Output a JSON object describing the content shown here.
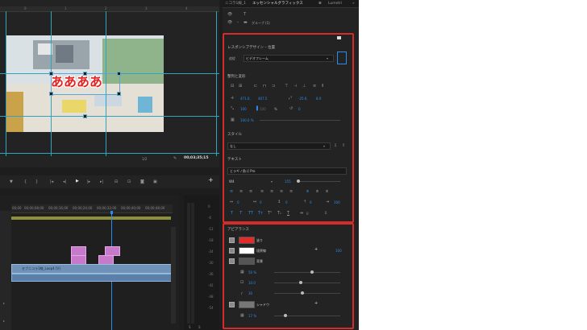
{
  "monitor": {
    "timecode": "00;03;35;15",
    "fit": "1/2",
    "overlay_text": "ああああ",
    "ruler_marks": [
      "0",
      "1",
      "2",
      "3",
      "4",
      "5"
    ]
  },
  "timeline": {
    "ruler_labels": [
      "00;00",
      "00;00;08;00",
      "00;00;16;00",
      "00;00;24;00",
      "00;00;32;00",
      "00;00;40;00",
      "00;00;48;00"
    ],
    "clip_name": "セブニコラ1線_Loop4 [V]",
    "meter_ticks": [
      "0",
      "-6",
      "-12",
      "-18",
      "-24",
      "-30",
      "-36",
      "-42",
      "-48",
      "-54"
    ],
    "meter_bottom": [
      "S",
      "S"
    ]
  },
  "tabs": [
    "ニコラ1線_1",
    "エッセンシャルグラフィックス",
    "≡",
    "Lumetri",
    "»"
  ],
  "layers": {
    "text_layer_icon": "T",
    "group_label": "グループ (1)"
  },
  "responsive": {
    "title": "レスポンシブデザイン – 位置",
    "follow_label": "追従",
    "follow_value": "ビデオフレーム"
  },
  "align": {
    "title": "整列と変形",
    "position_x": "471.6,",
    "position_y": "467.5",
    "anchor_x": "-25.6,",
    "anchor_y": "8.0",
    "scale": "100",
    "scale2": "100",
    "percent": "%",
    "rotation": "0",
    "opacity": "100.0 %"
  },
  "style": {
    "title": "スタイル",
    "value": "なし"
  },
  "text": {
    "title": "テキスト",
    "font": "ヒラギノ角ゴ Pro",
    "weight": "W4",
    "size": "155",
    "tracking": "0",
    "leading": "0",
    "kerning": "0",
    "tsume": "0",
    "baseline": "0",
    "tab_width": "100"
  },
  "appearance": {
    "title": "アピアランス",
    "fill_label": "塗り",
    "fill_color": "#e62a2a",
    "stroke_label": "境界線",
    "stroke_color": "#ffffff",
    "stroke_width": "100",
    "bg_label": "背景",
    "bg_color": "#555555",
    "bg_opacity": "50 %",
    "bg_size": "10.0",
    "bg_corner": "30",
    "shadow_label": "シャドウ",
    "shadow_color": "#777777",
    "shadow_opacity": "17 %"
  }
}
